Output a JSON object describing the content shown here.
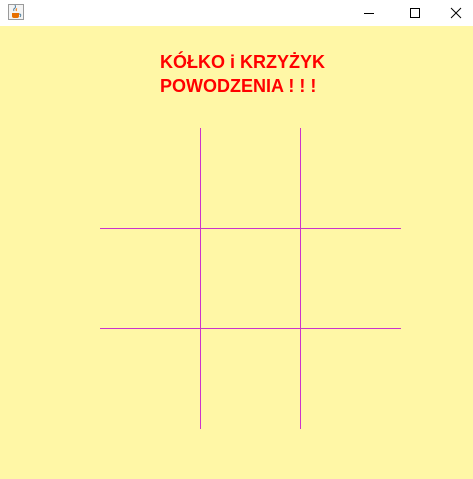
{
  "window": {
    "icon": "java-coffee-cup-icon",
    "controls": [
      "minimize-icon",
      "maximize-icon",
      "close-icon"
    ]
  },
  "game": {
    "title_line1": "KÓŁKO i KRZYŻYK",
    "title_line2": "POWODZENIA ! ! !",
    "title_color": "#ff0000",
    "background_color": "#fff7a6",
    "grid_color": "#cc33cc",
    "board": [
      [
        "",
        "",
        ""
      ],
      [
        "",
        "",
        ""
      ],
      [
        "",
        "",
        ""
      ]
    ]
  }
}
